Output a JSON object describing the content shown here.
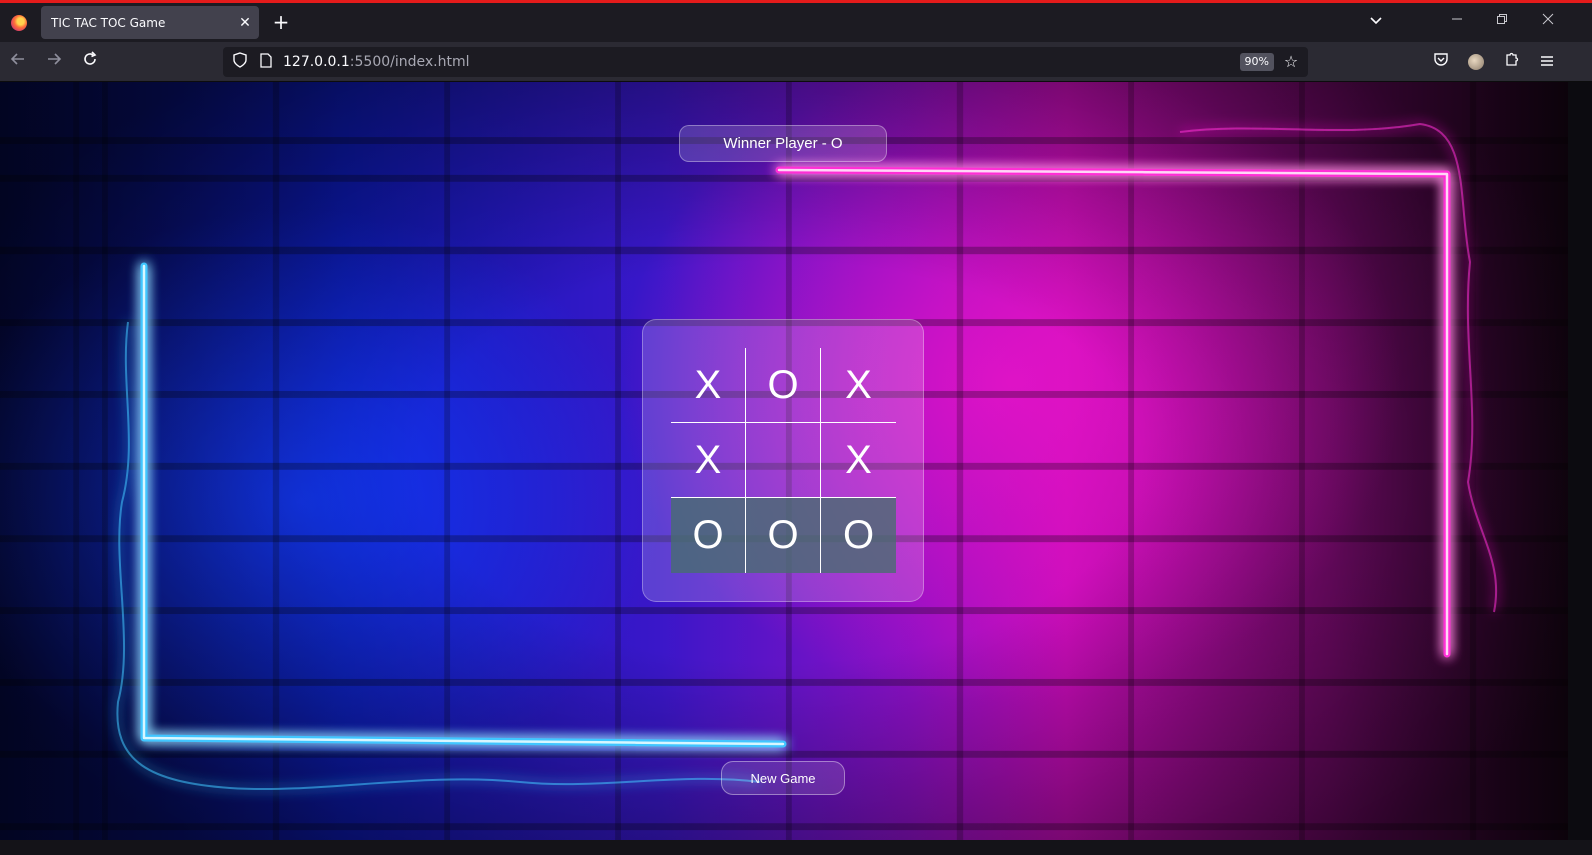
{
  "browser": {
    "tab_title": "TIC TAC TOC Game",
    "tab_close": "✕",
    "new_tab": "+",
    "url_host": "127.0.0.1",
    "url_path": ":5500/index.html",
    "zoom": "90%"
  },
  "game": {
    "status": "Winner Player - O",
    "board": [
      [
        "X",
        "O",
        "X"
      ],
      [
        "X",
        "",
        "X"
      ],
      [
        "O",
        "O",
        "O"
      ]
    ],
    "winning_row": 2,
    "new_game_label": "New Game"
  },
  "colors": {
    "neon_blue": "#3fc6ff",
    "neon_pink": "#ff2fd6",
    "win_cell": "#466e6e"
  }
}
